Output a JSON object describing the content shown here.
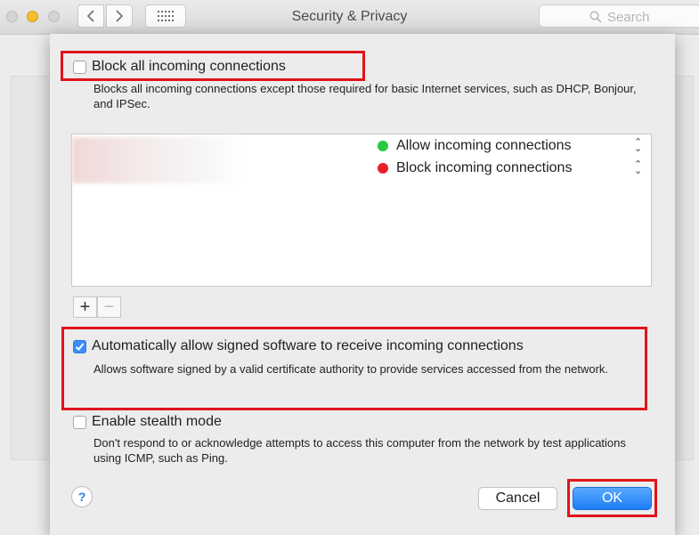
{
  "window": {
    "title": "Security & Privacy",
    "search_placeholder": "Search"
  },
  "firewall_options": {
    "block_all": {
      "label": "Block all incoming connections",
      "checked": false,
      "description": "Blocks all incoming connections except those required for basic Internet services,  such as DHCP, Bonjour, and IPSec."
    },
    "app_list": {
      "items": [
        {
          "status": "Allow incoming connections",
          "color": "#27c93f"
        },
        {
          "status": "Block incoming connections",
          "color": "#e8202a"
        }
      ],
      "add_label": "+",
      "remove_label": "−"
    },
    "auto_allow_signed": {
      "label": "Automatically allow signed software to receive incoming connections",
      "checked": true,
      "description": "Allows software signed by a valid certificate authority to provide services accessed from the network."
    },
    "stealth_mode": {
      "label": "Enable stealth mode",
      "checked": false,
      "description": "Don't respond to or acknowledge attempts to access this computer from the network by test applications using ICMP, such as Ping."
    }
  },
  "buttons": {
    "help": "?",
    "cancel": "Cancel",
    "ok": "OK"
  },
  "colors": {
    "highlight": "#e0141b",
    "accent": "#1d7df5"
  }
}
